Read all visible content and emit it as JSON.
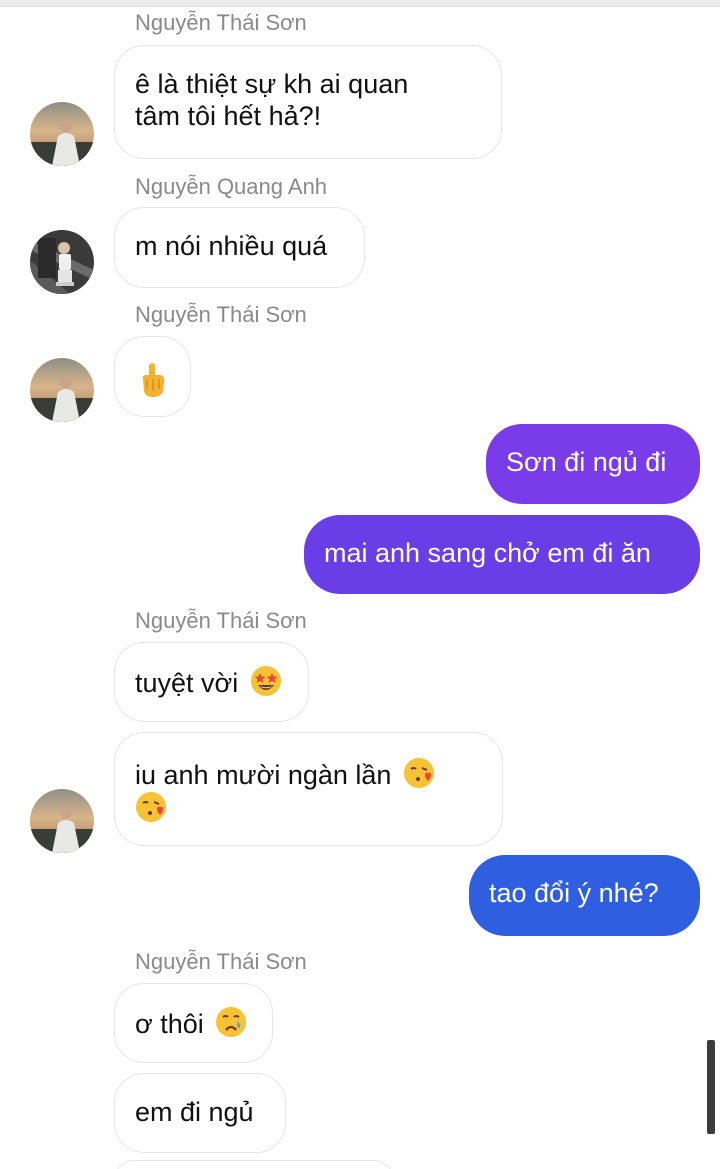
{
  "messages": [
    {
      "id": "m1",
      "sender": "Nguyễn Thái Sơn",
      "text": "ê là thiệt sự kh ai quan tâm tôi hết hả?!"
    },
    {
      "id": "m2",
      "sender": "Nguyễn Quang Anh",
      "text": "m nói nhiều quá"
    },
    {
      "id": "m3",
      "sender": "Nguyễn Thái Sơn",
      "emoji": "backhand-index-pointing-down"
    },
    {
      "id": "m4",
      "outgoing": true,
      "text": "Sơn đi ngủ đi",
      "color": "#7a3be8"
    },
    {
      "id": "m5",
      "outgoing": true,
      "text": "mai anh sang chở em đi ăn",
      "color": "#6a3ee6"
    },
    {
      "id": "m6",
      "sender": "Nguyễn Thái Sơn",
      "text": "tuyệt vời",
      "emoji": "star-struck"
    },
    {
      "id": "m7",
      "text": "iu anh mười ngàn lần",
      "emoji": "face-blowing-kiss"
    },
    {
      "id": "m8",
      "outgoing": true,
      "text": "tao đổi ý nhé?",
      "color": "#2f5fe0"
    },
    {
      "id": "m9",
      "sender": "Nguyễn Thái Sơn",
      "text": "ơ thôi",
      "emoji": "crying-face"
    },
    {
      "id": "m10",
      "text": "em đi ngủ"
    }
  ],
  "m1": {
    "sender": "Nguyễn Thái Sơn",
    "line1": "ê là thiệt sự kh ai quan",
    "line2": "tâm tôi hết hả?!"
  },
  "m2": {
    "sender": "Nguyễn Quang Anh",
    "text": "m nói nhiều quá"
  },
  "m3": {
    "sender": "Nguyễn Thái Sơn"
  },
  "m4": {
    "text": "Sơn đi ngủ đi"
  },
  "m5": {
    "text": "mai anh sang chở em đi ăn"
  },
  "m6": {
    "sender": "Nguyễn Thái Sơn",
    "text": "tuyệt vời"
  },
  "m7": {
    "text": "iu anh mười ngàn lần"
  },
  "m8": {
    "text": "tao đổi ý nhé?"
  },
  "m9": {
    "sender": "Nguyễn Thái Sơn",
    "text": "ơ thôi"
  },
  "m10": {
    "text": "em đi ngủ"
  },
  "colors": {
    "outgoing_purple": "#7a3be8",
    "outgoing_indigo": "#6a3ee6",
    "outgoing_blue": "#2f5fe0",
    "incoming_bg": "#ffffff",
    "sender_text": "#8a8a8a"
  }
}
